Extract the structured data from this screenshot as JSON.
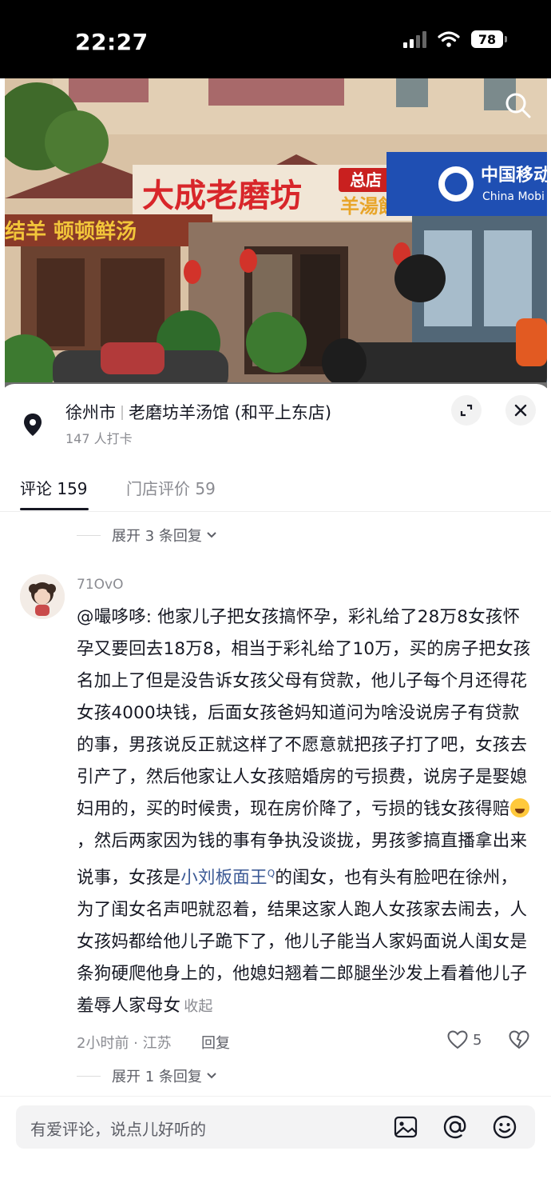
{
  "status_bar": {
    "time": "22:27",
    "battery": "78"
  },
  "hero": {
    "sign_main": "大成老磨坊",
    "sign_suffix": "羊湯館",
    "branch_badge": "总店",
    "sign_left": "结羊 顿顿鲜汤",
    "shop_right": "中国移动",
    "shop_right_en": "China Mobi"
  },
  "location": {
    "city": "徐州市",
    "shop_name": "老磨坊羊汤馆 (和平上东店)",
    "checkins": "147 人打卡"
  },
  "tabs": [
    {
      "label": "评论 159",
      "active": true
    },
    {
      "label": "门店评价 59",
      "active": false
    }
  ],
  "expand_top": "展开 3 条回复",
  "comment": {
    "username": "71OvO",
    "text_before_emoji": "@嘬哆哆: 他家儿子把女孩搞怀孕，彩礼给了28万8女孩怀孕又要回去18万8，相当于彩礼给了10万，买的房子把女孩名加上了但是没告诉女孩父母有贷款，他儿子每个月还得花女孩4000块钱，后面女孩爸妈知道问为啥没说房子有贷款的事，男孩说反正就这样了不愿意就把孩子打了吧，女孩去引产了，然后他家让人女孩赔婚房的亏损费，说房子是娶媳妇用的，买的时候贵，现在房价降了，亏损的钱女孩得赔",
    "text_mid": "，然后两家因为钱的事有争执没谈拢，男孩爹搞直播拿出来说事，女孩是",
    "link_text": "小刘板面王",
    "text_after_link": "的闺女，也有头有脸吧在徐州，为了闺女名声吧就忍着，结果这家人跑人女孩家去闹去，人女孩妈都给他儿子跪下了，他儿子能当人家妈面说人闺女是条狗硬爬他身上的，他媳妇翘着二郎腿坐沙发上看着他儿子羞辱人家母女",
    "fold_label": "收起",
    "meta": "2小时前 · 江苏",
    "reply_label": "回复",
    "likes": "5"
  },
  "expand_bottom": "展开 1 条回复",
  "input": {
    "placeholder": "有爱评论，说点儿好听的"
  },
  "icons": {
    "search": "search-icon",
    "location": "location-pin-icon",
    "expand": "expand-icon",
    "close": "close-icon",
    "like": "heart-icon",
    "dislike": "dislike-heart-icon",
    "image": "image-icon",
    "mention": "at-icon",
    "emoji": "emoji-icon"
  }
}
